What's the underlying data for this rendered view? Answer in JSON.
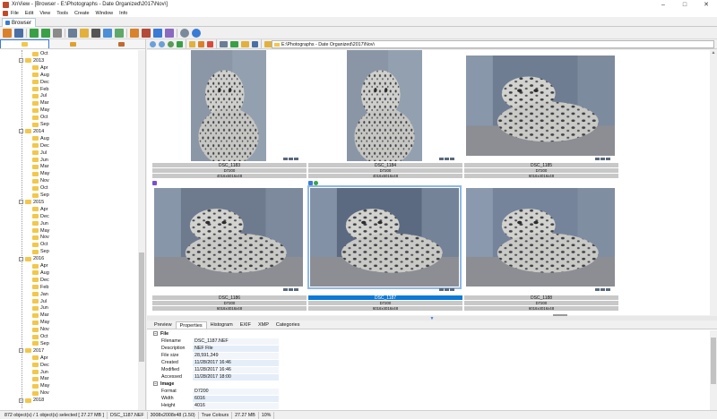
{
  "window": {
    "title": "XnView - [Browser - E:\\Photographs - Date Organized\\2017\\Nov\\]",
    "controls": [
      "–",
      "□",
      "✕"
    ]
  },
  "menu": [
    "File",
    "Edit",
    "View",
    "Tools",
    "Create",
    "Window",
    "Info"
  ],
  "tab": {
    "label": "Browser"
  },
  "address": {
    "path": "E:\\Photographs - Date Organized\\2017\\Nov\\"
  },
  "tree": [
    {
      "label": "Oct",
      "level": 3
    },
    {
      "label": "2013",
      "level": 2,
      "expander": "−"
    },
    {
      "label": "Apr",
      "level": 3
    },
    {
      "label": "Aug",
      "level": 3
    },
    {
      "label": "Dec",
      "level": 3
    },
    {
      "label": "Feb",
      "level": 3
    },
    {
      "label": "Jul",
      "level": 3
    },
    {
      "label": "Mar",
      "level": 3
    },
    {
      "label": "May",
      "level": 3
    },
    {
      "label": "Oct",
      "level": 3
    },
    {
      "label": "Sep",
      "level": 3
    },
    {
      "label": "2014",
      "level": 2,
      "expander": "−"
    },
    {
      "label": "Aug",
      "level": 3
    },
    {
      "label": "Dec",
      "level": 3
    },
    {
      "label": "Jul",
      "level": 3
    },
    {
      "label": "Jun",
      "level": 3
    },
    {
      "label": "Mar",
      "level": 3
    },
    {
      "label": "May",
      "level": 3
    },
    {
      "label": "Nov",
      "level": 3
    },
    {
      "label": "Oct",
      "level": 3
    },
    {
      "label": "Sep",
      "level": 3
    },
    {
      "label": "2015",
      "level": 2,
      "expander": "−"
    },
    {
      "label": "Apr",
      "level": 3
    },
    {
      "label": "Dec",
      "level": 3
    },
    {
      "label": "Jun",
      "level": 3
    },
    {
      "label": "May",
      "level": 3
    },
    {
      "label": "Nov",
      "level": 3
    },
    {
      "label": "Oct",
      "level": 3
    },
    {
      "label": "Sep",
      "level": 3
    },
    {
      "label": "2016",
      "level": 2,
      "expander": "−"
    },
    {
      "label": "Apr",
      "level": 3
    },
    {
      "label": "Aug",
      "level": 3
    },
    {
      "label": "Dec",
      "level": 3
    },
    {
      "label": "Feb",
      "level": 3
    },
    {
      "label": "Jan",
      "level": 3
    },
    {
      "label": "Jul",
      "level": 3
    },
    {
      "label": "Jun",
      "level": 3
    },
    {
      "label": "Mar",
      "level": 3
    },
    {
      "label": "May",
      "level": 3
    },
    {
      "label": "Nov",
      "level": 3
    },
    {
      "label": "Oct",
      "level": 3
    },
    {
      "label": "Sep",
      "level": 3
    },
    {
      "label": "2017",
      "level": 2,
      "expander": "−"
    },
    {
      "label": "Apr",
      "level": 3
    },
    {
      "label": "Dec",
      "level": 3
    },
    {
      "label": "Jun",
      "level": 3
    },
    {
      "label": "Mar",
      "level": 3
    },
    {
      "label": "May",
      "level": 3
    },
    {
      "label": "Nov",
      "level": 3
    },
    {
      "label": "2018",
      "level": 2,
      "expander": "+"
    }
  ],
  "thumbnails": [
    {
      "name": "DSC_1183",
      "camera": "D7200",
      "dims": "4016x6016x48",
      "selected": false,
      "badges": [],
      "scene": "portrait-a"
    },
    {
      "name": "DSC_1184",
      "camera": "D7200",
      "dims": "4016x6016x48",
      "selected": false,
      "badges": [],
      "scene": "portrait-b"
    },
    {
      "name": "DSC_1185",
      "camera": "D7200",
      "dims": "6016x4016x48",
      "selected": false,
      "badges": [],
      "scene": "land-a"
    },
    {
      "name": "DSC_1186",
      "camera": "D7200",
      "dims": "6016x4016x48",
      "selected": false,
      "badges": [
        "#7a4fd0"
      ],
      "scene": "land-b"
    },
    {
      "name": "DSC_1187",
      "camera": "D7200",
      "dims": "6016x4016x48",
      "selected": true,
      "badges": [
        "#3a7bd5",
        "#39a64a"
      ],
      "scene": "land-c"
    },
    {
      "name": "DSC_1188",
      "camera": "D7200",
      "dims": "6016x4016x48",
      "selected": false,
      "badges": [],
      "scene": "land-d"
    }
  ],
  "bottom_tabs": [
    "Preview",
    "Properties",
    "Histogram",
    "EXIF",
    "XMP",
    "Categories"
  ],
  "properties": [
    {
      "section": "File"
    },
    {
      "key": "Filename",
      "value": "DSC_1187.NEF"
    },
    {
      "key": "Description",
      "value": "NEF File"
    },
    {
      "key": "File size",
      "value": "28,591,349"
    },
    {
      "key": "Created",
      "value": "11/28/2017 16:46"
    },
    {
      "key": "Modified",
      "value": "11/28/2017 16:46"
    },
    {
      "key": "Accessed",
      "value": "11/28/2017 18:00"
    },
    {
      "section": "Image"
    },
    {
      "key": "Format",
      "value": "D7200"
    },
    {
      "key": "Width",
      "value": "6016"
    },
    {
      "key": "Height",
      "value": "4016"
    }
  ],
  "status": [
    "872 object(s) / 1 object(s) selected  [ 27.27 MB ]",
    "DSC_1187.NEF",
    "3008x2008x48 (1.50)",
    "True Colours",
    "27.27 MB",
    "10%"
  ],
  "colors": {
    "accent": "#0b7ad8",
    "folder": "#f3c74a",
    "caption_bg": "#c8c8c8"
  }
}
